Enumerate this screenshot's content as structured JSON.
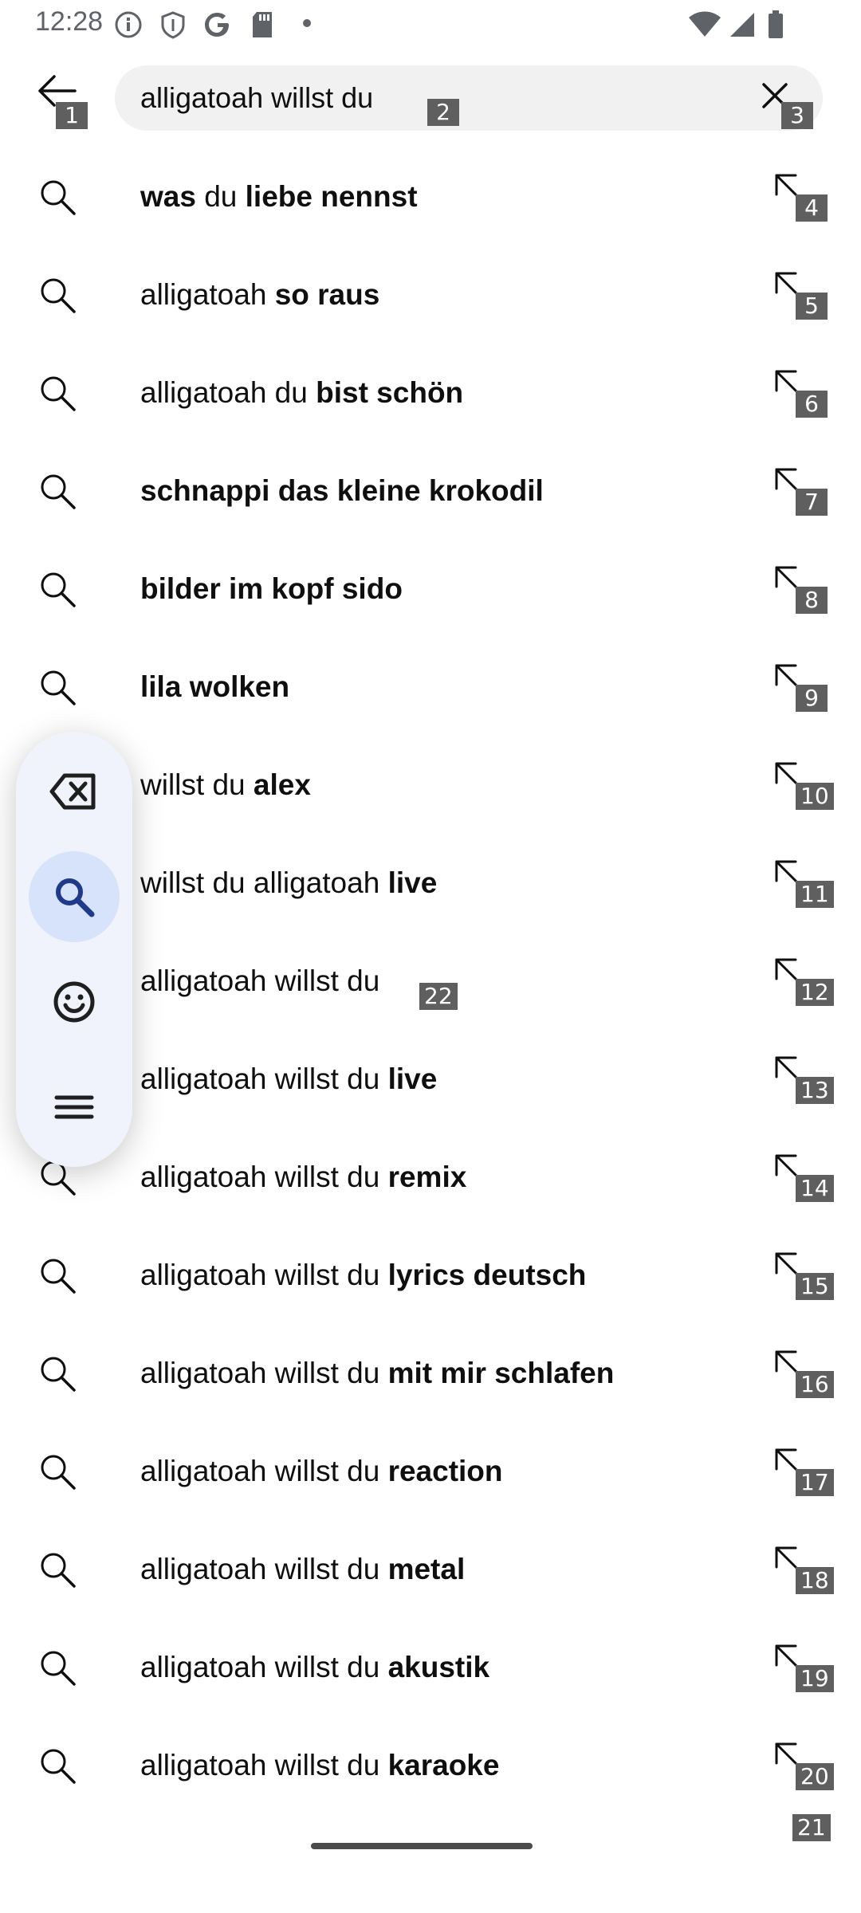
{
  "status_bar": {
    "time": "12:28",
    "left_icons": [
      "info-icon",
      "shield-icon",
      "google-icon",
      "sd-card-icon",
      "dot-icon"
    ],
    "right_icons": [
      "wifi-icon",
      "signal-icon",
      "battery-icon"
    ]
  },
  "search": {
    "query": "alligatoah willst du",
    "back_icon": "arrow-left-icon",
    "clear_icon": "close-icon"
  },
  "suggestions": [
    {
      "parts": [
        {
          "t": "was",
          "b": true
        },
        {
          "t": " du ",
          "b": false
        },
        {
          "t": "liebe nennst",
          "b": true
        }
      ]
    },
    {
      "parts": [
        {
          "t": "alligatoah ",
          "b": false
        },
        {
          "t": "so raus",
          "b": true
        }
      ]
    },
    {
      "parts": [
        {
          "t": "alligatoah du ",
          "b": false
        },
        {
          "t": "bist schön",
          "b": true
        }
      ]
    },
    {
      "parts": [
        {
          "t": "schnappi das kleine krokodil",
          "b": true
        }
      ]
    },
    {
      "parts": [
        {
          "t": "bilder im kopf sido",
          "b": true
        }
      ]
    },
    {
      "parts": [
        {
          "t": "lila wolken",
          "b": true
        }
      ]
    },
    {
      "parts": [
        {
          "t": "willst du ",
          "b": false
        },
        {
          "t": "alex",
          "b": true
        }
      ]
    },
    {
      "parts": [
        {
          "t": "willst du alligatoah ",
          "b": false
        },
        {
          "t": "live",
          "b": true
        }
      ]
    },
    {
      "parts": [
        {
          "t": "alligatoah willst du",
          "b": false
        }
      ]
    },
    {
      "parts": [
        {
          "t": "alligatoah willst du ",
          "b": false
        },
        {
          "t": "live",
          "b": true
        }
      ]
    },
    {
      "parts": [
        {
          "t": "alligatoah willst du ",
          "b": false
        },
        {
          "t": "remix",
          "b": true
        }
      ]
    },
    {
      "parts": [
        {
          "t": "alligatoah willst du ",
          "b": false
        },
        {
          "t": "lyrics deutsch",
          "b": true
        }
      ]
    },
    {
      "parts": [
        {
          "t": "alligatoah willst du ",
          "b": false
        },
        {
          "t": "mit mir schlafen",
          "b": true
        }
      ]
    },
    {
      "parts": [
        {
          "t": "alligatoah willst du ",
          "b": false
        },
        {
          "t": "reaction",
          "b": true
        }
      ]
    },
    {
      "parts": [
        {
          "t": "alligatoah willst du ",
          "b": false
        },
        {
          "t": "metal",
          "b": true
        }
      ]
    },
    {
      "parts": [
        {
          "t": "alligatoah willst du ",
          "b": false
        },
        {
          "t": "akustik",
          "b": true
        }
      ]
    },
    {
      "parts": [
        {
          "t": "alligatoah willst du ",
          "b": false
        },
        {
          "t": "karaoke",
          "b": true
        }
      ]
    }
  ],
  "floating_toolbar": {
    "buttons": [
      {
        "icon": "backspace-icon",
        "active": false
      },
      {
        "icon": "search-icon",
        "active": true
      },
      {
        "icon": "emoji-icon",
        "active": false
      },
      {
        "icon": "menu-icon",
        "active": false
      }
    ]
  },
  "badges": {
    "back": "1",
    "query": "2",
    "clear": "3",
    "fill": [
      "4",
      "5",
      "6",
      "7",
      "8",
      "9",
      "10",
      "11",
      "12",
      "13",
      "14",
      "15",
      "16",
      "17",
      "18",
      "19",
      "20"
    ],
    "inline": "22",
    "bottom": "21"
  }
}
